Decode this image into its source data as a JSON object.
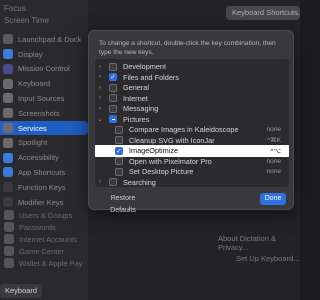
{
  "background": {
    "top_items": [
      "Focus",
      "Screen Time"
    ],
    "shortcuts_button": "Keyboard Shortcuts...",
    "sidebar": [
      {
        "label": "Launchpad & Dock",
        "color": "#5a5a5e"
      },
      {
        "label": "Display",
        "color": "#3b7be0"
      },
      {
        "label": "Mission Control",
        "color": "#4a4a8e"
      },
      {
        "label": "Keyboard",
        "color": "#6a6a6e"
      },
      {
        "label": "Input Sources",
        "color": "#6a6a6e"
      },
      {
        "label": "Screenshots",
        "color": "#6a6a6e"
      },
      {
        "label": "Services",
        "color": "#6a6a6e",
        "selected": true
      },
      {
        "label": "Spotlight",
        "color": "#6a6a6e"
      },
      {
        "label": "Accessibility",
        "color": "#3b7be0"
      },
      {
        "label": "App Shortcuts",
        "color": "#3b7be0"
      },
      {
        "label": "Function Keys",
        "color": "#3a3a3e"
      },
      {
        "label": "Modifier Keys",
        "color": "#3a3a3e"
      }
    ],
    "bottom_items": [
      "Users & Groups",
      "Passwords",
      "Internet Accounts",
      "Game Center",
      "Wallet & Apple Pay"
    ],
    "keyboard_label": "Keyboard",
    "right_links": [
      "About Dictation & Privacy...",
      "Set Up Keyboard..."
    ]
  },
  "sheet": {
    "instruction": "To change a shortcut, double-click the key combination, then type the new keys.",
    "rows": [
      {
        "label": "Development",
        "type": "group",
        "chev": "›",
        "check": "none"
      },
      {
        "label": "Files and Folders",
        "type": "group",
        "chev": "›",
        "check": "checked"
      },
      {
        "label": "General",
        "type": "group",
        "chev": "›",
        "check": "none"
      },
      {
        "label": "Internet",
        "type": "group",
        "chev": "›",
        "check": "none"
      },
      {
        "label": "Messaging",
        "type": "group",
        "chev": "›",
        "check": "none"
      },
      {
        "label": "Pictures",
        "type": "group",
        "chev": "⌄",
        "check": "mixed"
      },
      {
        "label": "Compare Images in Kaleidoscope",
        "type": "child",
        "check": "none",
        "shortcut": "none"
      },
      {
        "label": "Cleanup SVG with IconJar",
        "type": "child",
        "check": "none",
        "shortcut": "^⌘K"
      },
      {
        "label": "ImageOptimize",
        "type": "child",
        "check": "checked",
        "shortcut": "^⌥",
        "highlight": true
      },
      {
        "label": "Open with Pixelmator Pro",
        "type": "child",
        "check": "none",
        "shortcut": "none"
      },
      {
        "label": "Set Desktop Picture",
        "type": "child",
        "check": "none",
        "shortcut": "none"
      },
      {
        "label": "Searching",
        "type": "group",
        "chev": "›",
        "check": "none"
      }
    ],
    "restore_label": "Restore Defaults",
    "done_label": "Done"
  }
}
